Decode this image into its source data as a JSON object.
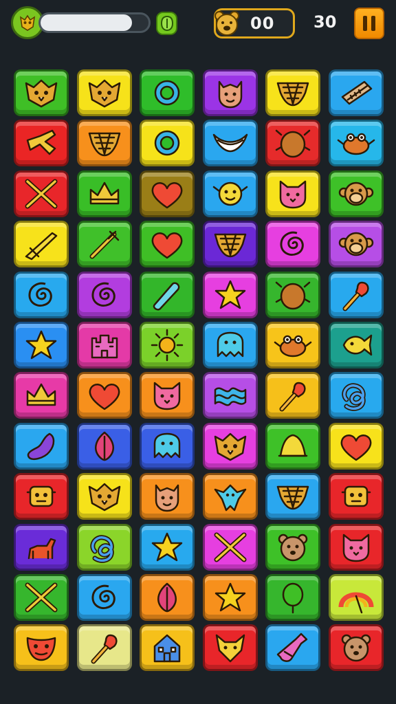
{
  "hud": {
    "health_fraction": 0.85,
    "score": "00",
    "moves": "30",
    "pause_label": "pause",
    "avatar_icon": "owl-avatar-icon",
    "gem_icon": "gem-icon",
    "score_icon": "bear-face-icon",
    "colors": {
      "accent": "#e0a81c",
      "pause": "#f59a10",
      "health": "#e9ecef",
      "background": "#1b2126"
    }
  },
  "board": {
    "rows": 12,
    "cols": 6,
    "tiles": [
      [
        {
          "color": "#3fbf26",
          "icon": "owl"
        },
        {
          "color": "#f6e21a",
          "icon": "owl"
        },
        {
          "color": "#2fbd2a",
          "icon": "ring"
        },
        {
          "color": "#9b34e6",
          "icon": "face"
        },
        {
          "color": "#f7e21b",
          "icon": "shell"
        },
        {
          "color": "#2aa7ef",
          "icon": "harmonica"
        }
      ],
      [
        {
          "color": "#ea2525",
          "icon": "dagger"
        },
        {
          "color": "#f7901c",
          "icon": "shell"
        },
        {
          "color": "#f6e21a",
          "icon": "ring"
        },
        {
          "color": "#2aa7ef",
          "icon": "boomerang"
        },
        {
          "color": "#e62b2b",
          "icon": "beetle"
        },
        {
          "color": "#26b7ea",
          "icon": "crab"
        }
      ],
      [
        {
          "color": "#e8262a",
          "icon": "cross-swords"
        },
        {
          "color": "#39be27",
          "icon": "crown"
        },
        {
          "color": "#9a7e17",
          "icon": "heart"
        },
        {
          "color": "#2aa7ef",
          "icon": "sun-face"
        },
        {
          "color": "#f7e21b",
          "icon": "cat-face"
        },
        {
          "color": "#3ec128",
          "icon": "monkey-face"
        }
      ],
      [
        {
          "color": "#f7e21b",
          "icon": "sword"
        },
        {
          "color": "#40c02a",
          "icon": "wand"
        },
        {
          "color": "#3fbf26",
          "icon": "heart"
        },
        {
          "color": "#6b28d6",
          "icon": "shell"
        },
        {
          "color": "#e63fe0",
          "icon": "spiral"
        },
        {
          "color": "#b64ee6",
          "icon": "monkey-face"
        }
      ],
      [
        {
          "color": "#28a9ee",
          "icon": "spiral"
        },
        {
          "color": "#b23ddf",
          "icon": "spiral"
        },
        {
          "color": "#33b62a",
          "icon": "capsule"
        },
        {
          "color": "#e63fe0",
          "icon": "star"
        },
        {
          "color": "#36b62d",
          "icon": "beetle"
        },
        {
          "color": "#28a9ee",
          "icon": "torch"
        }
      ],
      [
        {
          "color": "#2a8ff2",
          "icon": "star"
        },
        {
          "color": "#e43aa7",
          "icon": "castle"
        },
        {
          "color": "#7bd12a",
          "icon": "sun"
        },
        {
          "color": "#2aa7ef",
          "icon": "monster"
        },
        {
          "color": "#f7c41a",
          "icon": "crab"
        },
        {
          "color": "#1ca08e",
          "icon": "fish"
        }
      ],
      [
        {
          "color": "#e73aa7",
          "icon": "crown"
        },
        {
          "color": "#f7901c",
          "icon": "heart"
        },
        {
          "color": "#f7901c",
          "icon": "cat-face"
        },
        {
          "color": "#b64ee6",
          "icon": "wave"
        },
        {
          "color": "#f6c01a",
          "icon": "torch"
        },
        {
          "color": "#28a9ee",
          "icon": "knot"
        }
      ],
      [
        {
          "color": "#2aa7ef",
          "icon": "eggplant"
        },
        {
          "color": "#3a5fe6",
          "icon": "leaf"
        },
        {
          "color": "#3a5fe6",
          "icon": "monster"
        },
        {
          "color": "#e63fe0",
          "icon": "owl"
        },
        {
          "color": "#3ec128",
          "icon": "bell"
        },
        {
          "color": "#f7e21b",
          "icon": "heart"
        }
      ],
      [
        {
          "color": "#e8262a",
          "icon": "robot"
        },
        {
          "color": "#f6e21a",
          "icon": "owl"
        },
        {
          "color": "#f7901c",
          "icon": "face"
        },
        {
          "color": "#f7901c",
          "icon": "bird"
        },
        {
          "color": "#2aa7ef",
          "icon": "shell"
        },
        {
          "color": "#e8262a",
          "icon": "robot"
        }
      ],
      [
        {
          "color": "#6a2cd8",
          "icon": "goat"
        },
        {
          "color": "#8bd52a",
          "icon": "knot"
        },
        {
          "color": "#28a9ee",
          "icon": "star"
        },
        {
          "color": "#e63fe0",
          "icon": "cross-swords"
        },
        {
          "color": "#3ec128",
          "icon": "bear-face"
        },
        {
          "color": "#e8262a",
          "icon": "cat-face"
        }
      ],
      [
        {
          "color": "#36b62d",
          "icon": "cross-swords"
        },
        {
          "color": "#2aa7ef",
          "icon": "spiral"
        },
        {
          "color": "#f7901c",
          "icon": "leaf"
        },
        {
          "color": "#f7901c",
          "icon": "star"
        },
        {
          "color": "#36b62d",
          "icon": "balloon"
        },
        {
          "color": "#c8e83a",
          "icon": "rainbow"
        }
      ],
      [
        {
          "color": "#f6c01a",
          "icon": "mask"
        },
        {
          "color": "#e7e78a",
          "icon": "torch"
        },
        {
          "color": "#f6c01a",
          "icon": "house"
        },
        {
          "color": "#e8262a",
          "icon": "fox-face"
        },
        {
          "color": "#2aa7ef",
          "icon": "bottle"
        },
        {
          "color": "#e8262a",
          "icon": "bear-face"
        }
      ]
    ]
  }
}
